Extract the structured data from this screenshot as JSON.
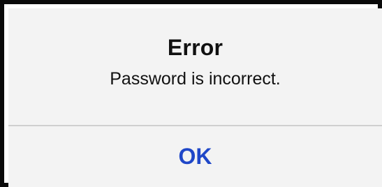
{
  "alert": {
    "title": "Error",
    "message": "Password is incorrect.",
    "ok_label": "OK"
  },
  "colors": {
    "background": "#f3f3f3",
    "border": "#0a0a0a",
    "divider": "#cfcfcf",
    "button_text": "#1f47c8"
  }
}
